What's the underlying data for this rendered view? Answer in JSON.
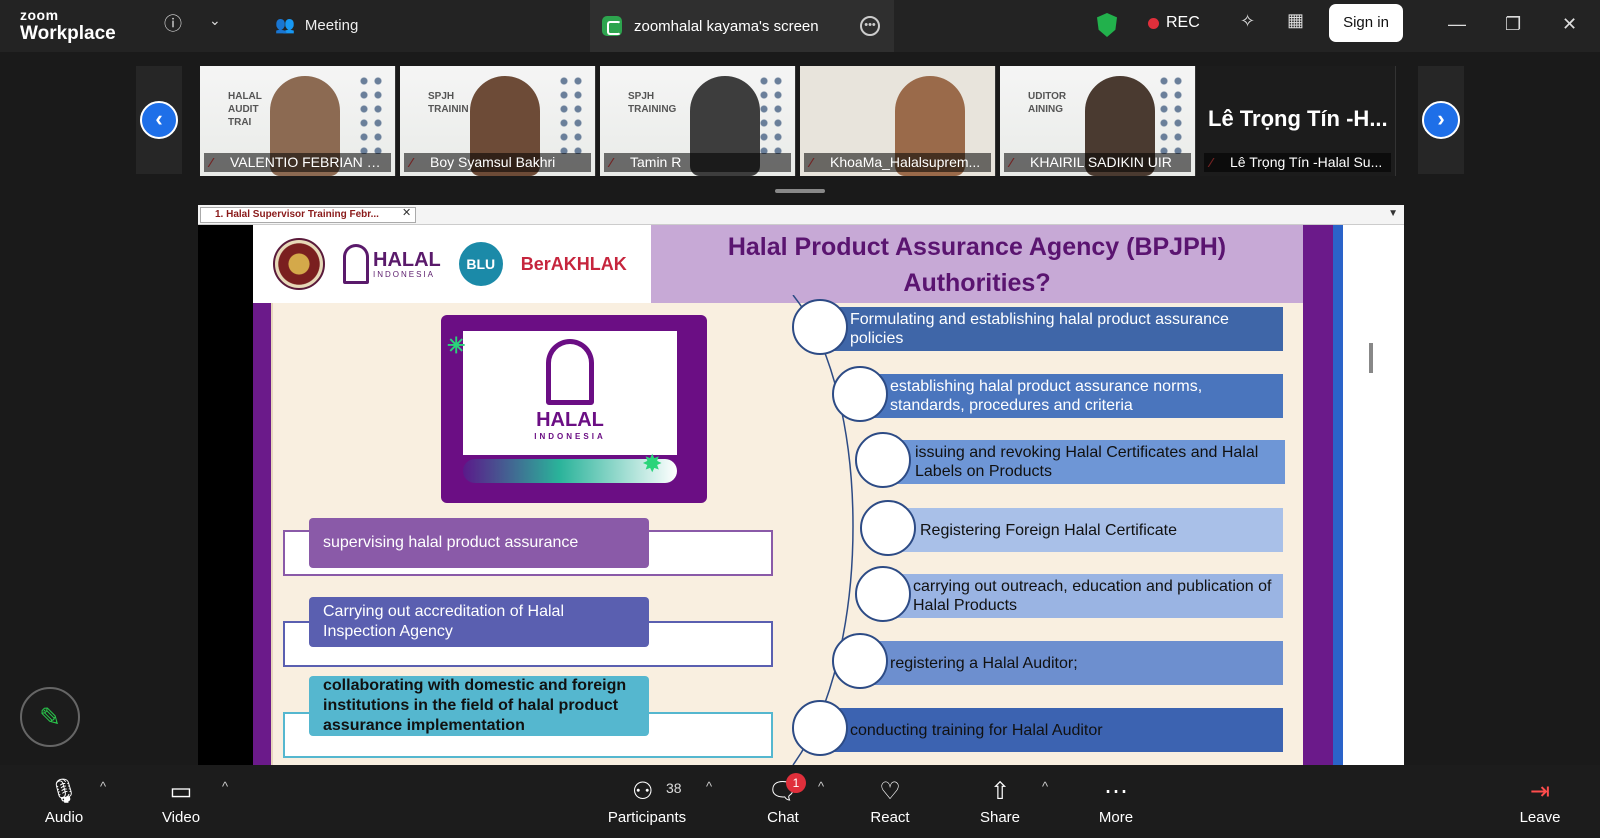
{
  "app": {
    "brand_line1": "zoom",
    "brand_line2": "Workplace",
    "meeting_label": "Meeting",
    "screen_tab": "zoomhalal kayama's screen",
    "rec": "REC",
    "signin": "Sign in"
  },
  "gallery": {
    "tiles": [
      {
        "name": "VALENTIO FEBRIAN PR...",
        "deco": "HALAL\nAUDIT\nTRAI"
      },
      {
        "name": "Boy Syamsul Bakhri",
        "deco": "SPJH\nTRAININ"
      },
      {
        "name": "Tamin R",
        "deco": "SPJH\nTRAINING"
      },
      {
        "name": "KhoaMa_Halalsuprem...",
        "deco": ""
      },
      {
        "name": "KHAIRIL SADIKIN UIR",
        "deco": "UDITOR\nAINING"
      },
      {
        "name": "Lê Trọng Tín -Halal Su...",
        "big": "Lê Trọng Tín -H..."
      }
    ]
  },
  "doc": {
    "tab_title": "1. Halal Supervisor Training Febr..."
  },
  "slide": {
    "title_line1": "Halal Product Assurance Agency (BPJPH)",
    "title_line2": "Authorities?",
    "logo_word": "HALAL",
    "logo_sub": "INDONESIA",
    "header_halal": "HALAL",
    "header_halal_sub": "INDONESIA",
    "blu": "BLU",
    "berakhlak": "BerAKHLAK",
    "left_items": [
      {
        "text": "supervising halal product assurance",
        "color": "#8a5aa8",
        "frame": "#8a5aa8"
      },
      {
        "text": "Carrying out accreditation of Halal Inspection Agency",
        "color": "#5a5fb0",
        "frame": "#5a5fb0"
      },
      {
        "text": "collaborating with domestic and foreign institutions in the field of halal product assurance implementation",
        "color": "#55b7cf",
        "frame": "#55b7cf",
        "bold": true
      }
    ],
    "right_items": [
      {
        "text": "Formulating  and establishing  halal product assurance policies",
        "color": "#3f66a8"
      },
      {
        "text": "establishing halal product assurance norms, standards, procedures and criteria",
        "color": "#4a75bd"
      },
      {
        "text": "issuing and revoking Halal Certificates and Halal Labels on Products",
        "color": "#6e96d6"
      },
      {
        "text": "Registering Foreign Halal Certificate",
        "color": "#a9c0e8"
      },
      {
        "text": "carrying out outreach, education and publication of Halal Products",
        "color": "#9ab4e3"
      },
      {
        "text": "registering a Halal Auditor;",
        "color": "#6d8fcf"
      },
      {
        "text": "conducting training for Halal Auditor",
        "color": "#3c63b1"
      }
    ]
  },
  "toolbar": {
    "audio": "Audio",
    "video": "Video",
    "participants": "Participants",
    "participants_count": "38",
    "chat": "Chat",
    "chat_badge": "1",
    "react": "React",
    "share": "Share",
    "more": "More",
    "leave": "Leave"
  }
}
